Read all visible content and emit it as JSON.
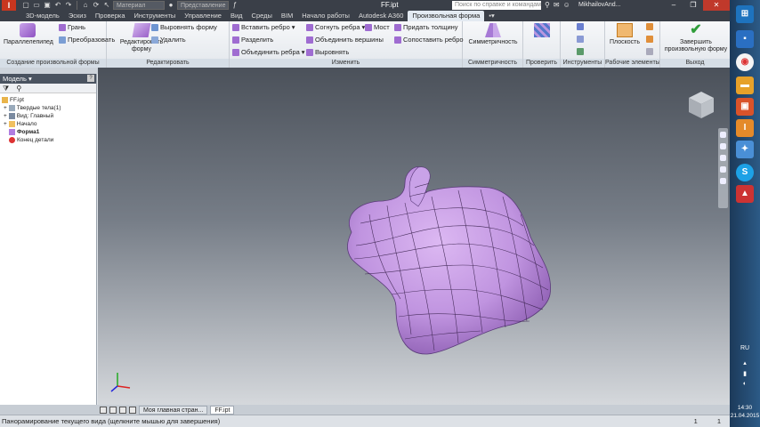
{
  "titlebar": {
    "doc_title": "FF.ipt",
    "search_placeholder": "Поиск по справке и командам",
    "user": "MikhailovAnd...",
    "qat_material": "Материал",
    "qat_appearance": "Представление"
  },
  "tabs": [
    "3D-модель",
    "Эскиз",
    "Проверка",
    "Инструменты",
    "Управление",
    "Вид",
    "Среды",
    "BIM",
    "Начало работы",
    "Autodesk A360",
    "Произвольная форма"
  ],
  "active_tab": "Произвольная форма",
  "ribbon": {
    "panels": {
      "create": "Создание произвольной формы",
      "edit": "Редактировать",
      "modify": "Изменить",
      "symmetry": "Симметричность",
      "check": "Проверить",
      "tools": "Инструменты",
      "work": "Рабочие элементы",
      "exit": "Выход"
    },
    "buttons": {
      "box": "Параллелепипед",
      "face": "Грань",
      "convert": "Преобразовать",
      "edit_form_1": "Редактировать",
      "edit_form_2": "форму",
      "align_form": "Выровнять форму",
      "delete": "Удалить",
      "insert_edge": "Вставить ребро",
      "subdivide": "Разделить",
      "merge_edges": "Объединить ребра",
      "crease_edges": "Согнуть ребра",
      "merge_vertices": "Объединить вершины",
      "align": "Выровнять",
      "bridge": "Мост",
      "thicken": "Придать толщину",
      "match_edge": "Сопоставить ребро",
      "symmetry": "Симметричность",
      "plane": "Плоскость",
      "finish_1": "Завершить",
      "finish_2": "произвольную форму"
    }
  },
  "browser": {
    "title": "Модель",
    "help": "?",
    "items": [
      {
        "label": "FF.ipt",
        "bold": false
      },
      {
        "label": "Твердые тела(1)",
        "bold": false
      },
      {
        "label": "Вид: Главный",
        "bold": false
      },
      {
        "label": "Начало",
        "bold": false
      },
      {
        "label": "Форма1",
        "bold": true
      },
      {
        "label": "Конец детали",
        "bold": false
      }
    ]
  },
  "doc_tabs": {
    "home": "Моя главная стран...",
    "file": "FF.ipt"
  },
  "status": {
    "message": "Панорамирование текущего вида (щелкните мышью для завершения)",
    "num1": "1",
    "num2": "1"
  },
  "taskbar": {
    "lang": "RU",
    "time": "14:30",
    "date": "21.04.2015"
  },
  "colors": {
    "form_fill": "#c99be3",
    "accent_tab": "#e3eaf2",
    "ribbon_title": "#d6dee6"
  }
}
